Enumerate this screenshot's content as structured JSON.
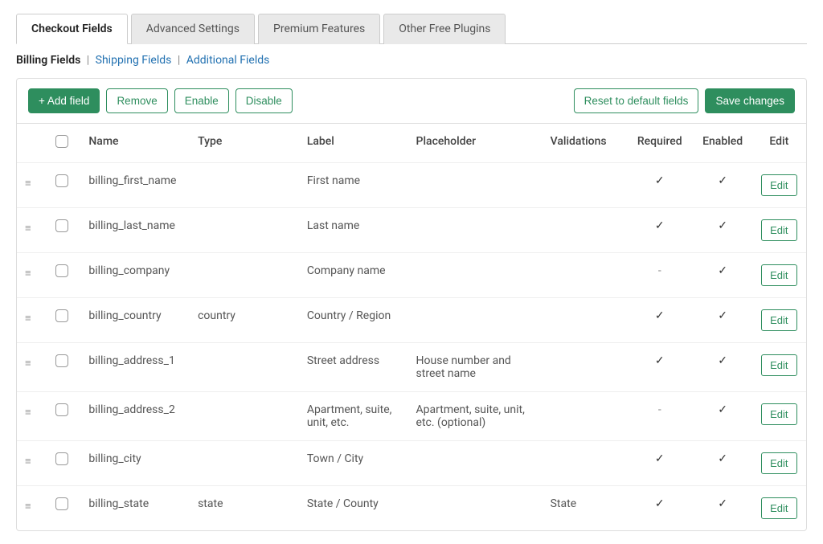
{
  "tabs": [
    {
      "label": "Checkout Fields",
      "active": true
    },
    {
      "label": "Advanced Settings",
      "active": false
    },
    {
      "label": "Premium Features",
      "active": false
    },
    {
      "label": "Other Free Plugins",
      "active": false
    }
  ],
  "subnav": [
    {
      "label": "Billing Fields",
      "active": true
    },
    {
      "label": "Shipping Fields",
      "active": false
    },
    {
      "label": "Additional Fields",
      "active": false
    }
  ],
  "toolbar": {
    "add": "+ Add field",
    "remove": "Remove",
    "enable": "Enable",
    "disable": "Disable",
    "reset": "Reset to default fields",
    "save": "Save changes"
  },
  "headers": {
    "name": "Name",
    "type": "Type",
    "label": "Label",
    "placeholder": "Placeholder",
    "validations": "Validations",
    "required": "Required",
    "enabled": "Enabled",
    "edit": "Edit"
  },
  "edit_label": "Edit",
  "rows": [
    {
      "name": "billing_first_name",
      "type": "",
      "label": "First name",
      "placeholder": "",
      "validations": "",
      "required": "check",
      "enabled": "check"
    },
    {
      "name": "billing_last_name",
      "type": "",
      "label": "Last name",
      "placeholder": "",
      "validations": "",
      "required": "check",
      "enabled": "check"
    },
    {
      "name": "billing_company",
      "type": "",
      "label": "Company name",
      "placeholder": "",
      "validations": "",
      "required": "dash",
      "enabled": "check"
    },
    {
      "name": "billing_country",
      "type": "country",
      "label": "Country / Region",
      "placeholder": "",
      "validations": "",
      "required": "check",
      "enabled": "check"
    },
    {
      "name": "billing_address_1",
      "type": "",
      "label": "Street address",
      "placeholder": "House number and street name",
      "validations": "",
      "required": "check",
      "enabled": "check"
    },
    {
      "name": "billing_address_2",
      "type": "",
      "label": "Apartment, suite, unit, etc.",
      "placeholder": "Apartment, suite, unit, etc. (optional)",
      "validations": "",
      "required": "dash",
      "enabled": "check"
    },
    {
      "name": "billing_city",
      "type": "",
      "label": "Town / City",
      "placeholder": "",
      "validations": "",
      "required": "check",
      "enabled": "check"
    },
    {
      "name": "billing_state",
      "type": "state",
      "label": "State / County",
      "placeholder": "",
      "validations": "State",
      "required": "check",
      "enabled": "check"
    }
  ]
}
